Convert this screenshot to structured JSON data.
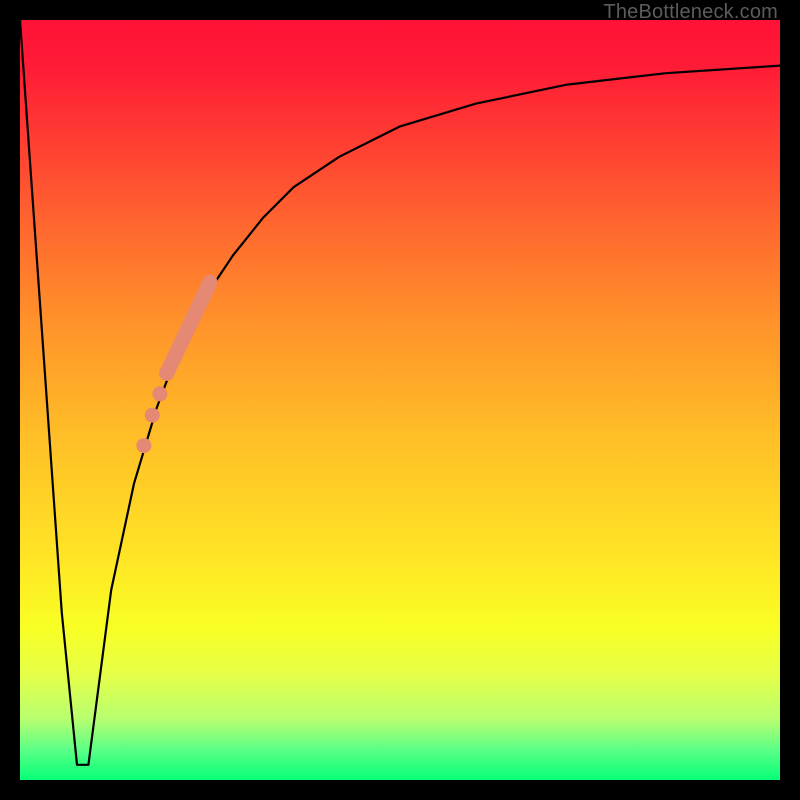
{
  "watermark": {
    "text": "TheBottleneck.com"
  },
  "chart_data": {
    "type": "line",
    "title": "",
    "xlabel": "",
    "ylabel": "",
    "xlim": [
      0,
      100
    ],
    "ylim": [
      0,
      100
    ],
    "series": [
      {
        "name": "bottleneck-curve",
        "x": [
          0,
          5.5,
          7.5,
          9.0,
          12,
          15,
          18,
          21,
          24,
          28,
          32,
          36,
          42,
          50,
          60,
          72,
          85,
          100
        ],
        "y": [
          100,
          22,
          2,
          2,
          25,
          39,
          49,
          57,
          63,
          69,
          74,
          78,
          82,
          86,
          89,
          91.5,
          93,
          94
        ]
      }
    ],
    "markers": [
      {
        "name": "highlight-segment",
        "shape": "thick-line",
        "color": "#e58874",
        "x": [
          19.3,
          25.0
        ],
        "y": [
          53.5,
          65.5
        ]
      },
      {
        "name": "dot-1",
        "shape": "circle",
        "color": "#e58874",
        "x": 18.4,
        "y": 50.8
      },
      {
        "name": "dot-2",
        "shape": "circle",
        "color": "#e58874",
        "x": 17.4,
        "y": 48.0
      },
      {
        "name": "dot-3",
        "shape": "circle",
        "color": "#e58874",
        "x": 16.3,
        "y": 44.0
      }
    ],
    "background": {
      "type": "vertical-gradient",
      "stops": [
        {
          "pos": 0.0,
          "color": "#ff1236"
        },
        {
          "pos": 0.4,
          "color": "#ff932a"
        },
        {
          "pos": 0.72,
          "color": "#ffe825"
        },
        {
          "pos": 0.96,
          "color": "#5bff86"
        },
        {
          "pos": 1.0,
          "color": "#06ff77"
        }
      ]
    }
  }
}
